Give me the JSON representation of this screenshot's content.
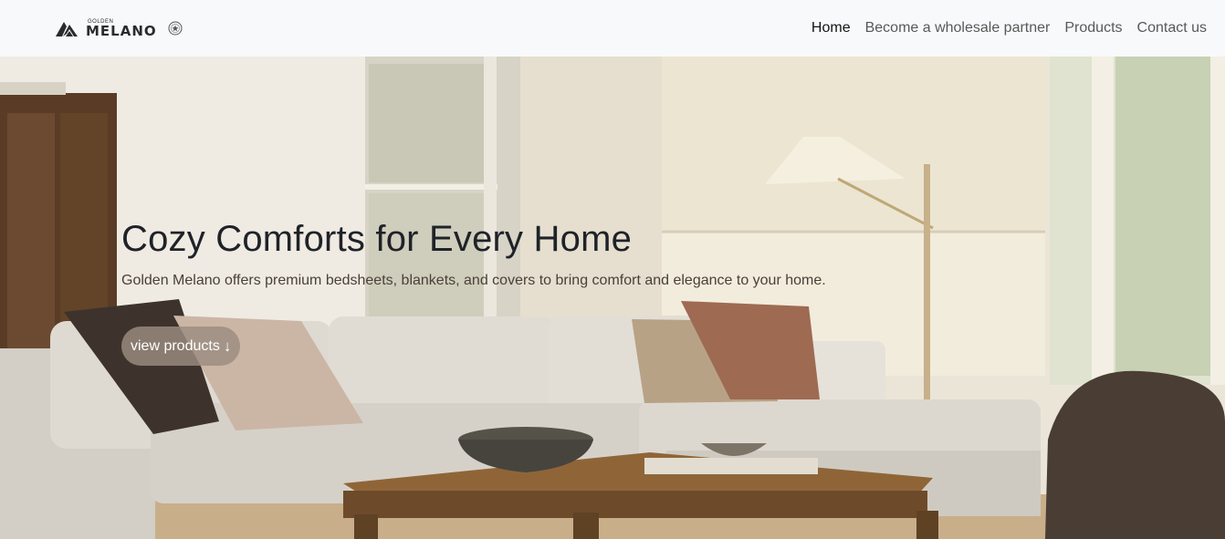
{
  "brand": {
    "small": "GOLDEN",
    "name": "MELANO",
    "logo_icon": "mountain-logo-icon",
    "seal_icon": "seal-badge-icon"
  },
  "nav": {
    "items": [
      {
        "label": "Home",
        "active": true
      },
      {
        "label": "Become a wholesale partner",
        "active": false
      },
      {
        "label": "Products",
        "active": false
      },
      {
        "label": "Contact us",
        "active": false
      }
    ]
  },
  "hero": {
    "title": "Cozy Comforts for Every Home",
    "subtitle": "Golden Melano offers premium bedsheets, blankets, and covers to bring comfort and elegance to your home.",
    "cta_label": "view products",
    "cta_icon": "↓"
  },
  "colors": {
    "navbar_bg": "#f8f9fa",
    "wall": "#e9e3d4",
    "sofa": "#d9d4cc",
    "table_wood": "#8f6538",
    "cta_bg": "#9b8c80"
  }
}
